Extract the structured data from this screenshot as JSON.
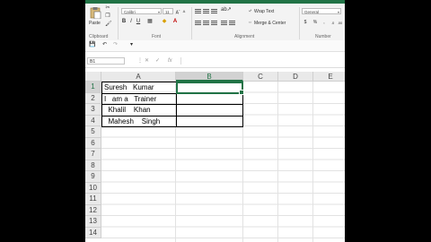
{
  "ribbon": {
    "paste_label": "Paste",
    "font_name": "Calibri",
    "font_size": "11",
    "bold": "B",
    "italic": "I",
    "underline": "U",
    "wrap_text": "Wrap Text",
    "merge_center": "Merge & Center",
    "number_format": "General",
    "currency": "$",
    "percent": "%",
    "comma": ",",
    "groups": {
      "clipboard": "Clipboard",
      "font": "Font",
      "alignment": "Alignment",
      "number": "Number"
    }
  },
  "formula_bar": {
    "name_box": "B1",
    "cancel": "✕",
    "enter": "✓",
    "fx": "fx",
    "formula": ""
  },
  "sheet": {
    "columns": [
      "A",
      "B",
      "C",
      "D",
      "E"
    ],
    "rows": [
      "1",
      "2",
      "3",
      "4",
      "5",
      "6",
      "7",
      "8",
      "9",
      "10",
      "11",
      "12",
      "13",
      "14"
    ],
    "selected_column": "B",
    "selected_row": "1",
    "cells": {
      "A1": "Suresh   Kumar",
      "A2": "I   am a   Trainer",
      "A3": "  Khalil    Khan",
      "A4": "  Mahesh    Singh"
    }
  }
}
